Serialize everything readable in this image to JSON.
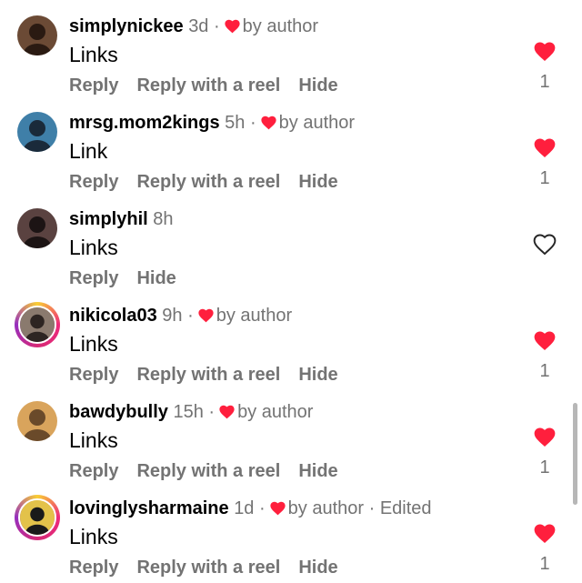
{
  "colors": {
    "heart_red": "#ff1f3d",
    "secondary_text": "#737373"
  },
  "comments": [
    {
      "username": "simplynickee",
      "time": "3d",
      "author_like": "by author",
      "edited": "",
      "text": "Links",
      "actions": [
        "Reply",
        "Reply with a reel",
        "Hide"
      ],
      "liked": true,
      "like_count": "1",
      "story_ring": false,
      "avatar_icon": "avatar-photo"
    },
    {
      "username": "mrsg.mom2kings",
      "time": "5h",
      "author_like": "by author",
      "edited": "",
      "text": "Link",
      "actions": [
        "Reply",
        "Reply with a reel",
        "Hide"
      ],
      "liked": true,
      "like_count": "1",
      "story_ring": false,
      "avatar_icon": "avatar-photo"
    },
    {
      "username": "simplyhil",
      "time": "8h",
      "author_like": "",
      "edited": "",
      "text": "Links",
      "actions": [
        "Reply",
        "Hide"
      ],
      "liked": false,
      "like_count": "",
      "story_ring": false,
      "avatar_icon": "avatar-photo"
    },
    {
      "username": "nikicola03",
      "time": "9h",
      "author_like": "by author",
      "edited": "",
      "text": "Links",
      "actions": [
        "Reply",
        "Reply with a reel",
        "Hide"
      ],
      "liked": true,
      "like_count": "1",
      "story_ring": true,
      "avatar_icon": "avatar-photo"
    },
    {
      "username": "bawdybully",
      "time": "15h",
      "author_like": "by author",
      "edited": "",
      "text": "Links",
      "actions": [
        "Reply",
        "Reply with a reel",
        "Hide"
      ],
      "liked": true,
      "like_count": "1",
      "story_ring": false,
      "avatar_icon": "avatar-photo"
    },
    {
      "username": "lovinglysharmaine",
      "time": "1d",
      "author_like": "by author",
      "edited": "Edited",
      "text": "Links",
      "actions": [
        "Reply",
        "Reply with a reel",
        "Hide"
      ],
      "liked": true,
      "like_count": "1",
      "story_ring": true,
      "avatar_icon": "avatar-photo"
    }
  ]
}
